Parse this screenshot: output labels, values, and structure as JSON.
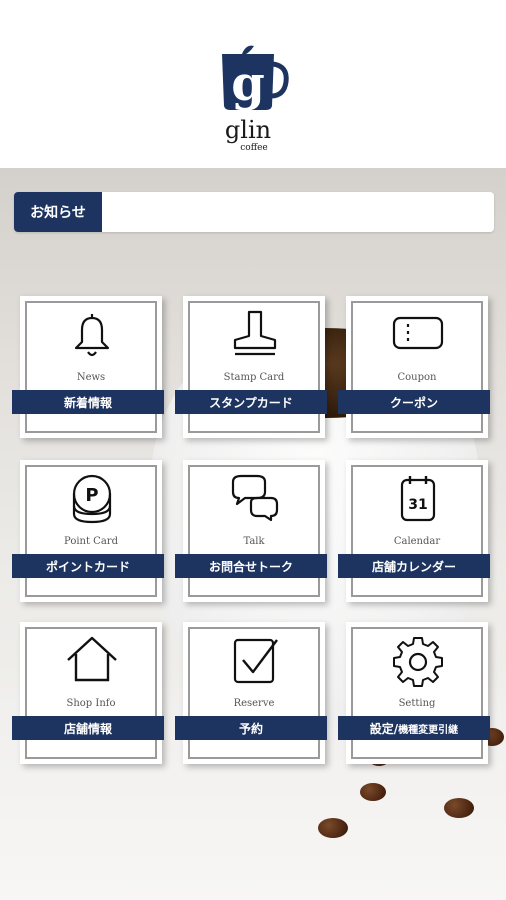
{
  "app": {
    "logo_text": "glin",
    "logo_subtext": "coffee"
  },
  "notice": {
    "label": "お知らせ",
    "text": ""
  },
  "menu": [
    {
      "en": "News",
      "jp": "新着情報",
      "icon": "bell-icon"
    },
    {
      "en": "Stamp Card",
      "jp": "スタンプカード",
      "icon": "stamp-icon"
    },
    {
      "en": "Coupon",
      "jp": "クーポン",
      "icon": "coupon-icon"
    },
    {
      "en": "Point Card",
      "jp": "ポイントカード",
      "icon": "coins-icon"
    },
    {
      "en": "Talk",
      "jp": "お問合せトーク",
      "icon": "chat-bubbles-icon"
    },
    {
      "en": "Calendar",
      "jp": "店舗カレンダー",
      "icon": "calendar-icon",
      "calendar_day": "31"
    },
    {
      "en": "Shop Info",
      "jp": "店舗情報",
      "icon": "house-icon"
    },
    {
      "en": "Reserve",
      "jp": "予約",
      "icon": "checkbox-icon"
    },
    {
      "en": "Setting",
      "jp": "設定/",
      "jp_small": "機種変更引継",
      "icon": "gear-icon"
    }
  ],
  "colors": {
    "brand_navy": "#1e3460",
    "tile_border": "#9a9a9a"
  }
}
